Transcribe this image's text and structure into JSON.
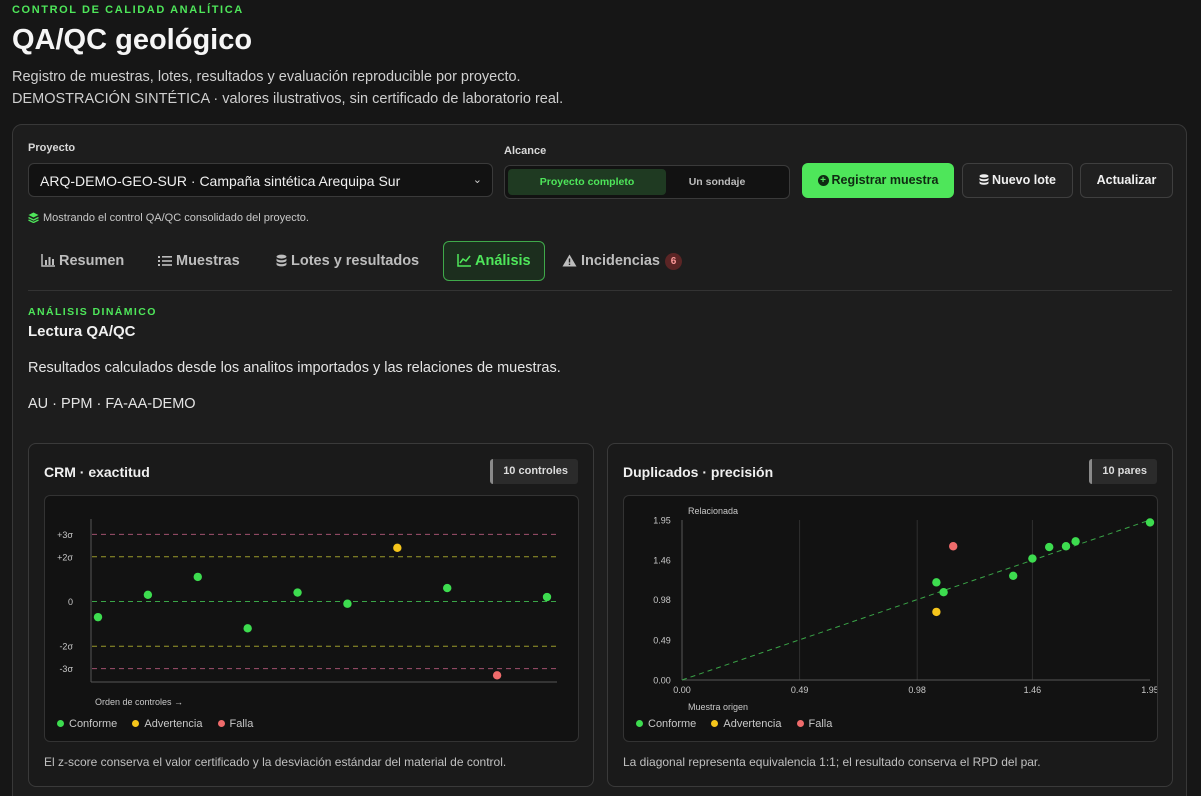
{
  "header": {
    "eyebrow": "CONTROL DE CALIDAD ANALÍTICA",
    "title": "QA/QC geológico",
    "subtitle1": "Registro de muestras, lotes, resultados y evaluación reproducible por proyecto.",
    "subtitle2": "DEMOSTRACIÓN SINTÉTICA · valores ilustrativos, sin certificado de laboratorio real."
  },
  "controls": {
    "project_label": "Proyecto",
    "project_value": "ARQ-DEMO-GEO-SUR · Campaña sintética Arequipa Sur",
    "scope_label": "Alcance",
    "scope_options": [
      "Proyecto completo",
      "Un sondaje"
    ],
    "register_button": "Registrar muestra",
    "new_batch_button": "Nuevo lote",
    "refresh_button": "Actualizar",
    "note": "Mostrando el control QA/QC consolidado del proyecto."
  },
  "tabs": [
    {
      "label": "Resumen",
      "icon": "bar-chart-icon"
    },
    {
      "label": "Muestras",
      "icon": "list-icon"
    },
    {
      "label": "Lotes y resultados",
      "icon": "database-icon"
    },
    {
      "label": "Análisis",
      "icon": "line-chart-icon",
      "active": true
    },
    {
      "label": "Incidencias",
      "icon": "warning-icon",
      "badge": "6"
    }
  ],
  "section": {
    "eyebrow": "ANÁLISIS DINÁMICO",
    "title": "Lectura QA/QC",
    "description": "Resultados calculados desde los analitos importados y las relaciones de muestras.",
    "meta": "AU · PPM · FA-AA-DEMO"
  },
  "colors": {
    "accent": "#4ee65a",
    "conforme": "#3ddc4f",
    "advertencia": "#f5c51b",
    "falla": "#ef6b6b"
  },
  "cards": {
    "crm": {
      "title": "CRM · exactitud",
      "pill": "10 controles",
      "footer": "El z-score conserva el valor certificado y la desviación estándar del material de control."
    },
    "dup": {
      "title": "Duplicados · precisión",
      "pill": "10 pares",
      "footer": "La diagonal representa equivalencia 1:1; el resultado conserva el RPD del par."
    }
  },
  "legend": [
    "Conforme",
    "Advertencia",
    "Falla"
  ],
  "chart_data": [
    {
      "type": "scatter",
      "title": "CRM · exactitud",
      "xlabel": "Orden de controles →",
      "ylabel": "",
      "y_ticks": [
        "+3σ",
        "+2σ",
        "0",
        "-2σ",
        "-3σ"
      ],
      "ylim": [
        -3.6,
        3.6
      ],
      "reference_lines": [
        3,
        2,
        0,
        -2,
        -3
      ],
      "points": [
        {
          "x": 1,
          "y": -0.7,
          "status": "Conforme"
        },
        {
          "x": 2,
          "y": 0.3,
          "status": "Conforme"
        },
        {
          "x": 3,
          "y": 1.1,
          "status": "Conforme"
        },
        {
          "x": 4,
          "y": -1.2,
          "status": "Conforme"
        },
        {
          "x": 5,
          "y": 0.4,
          "status": "Conforme"
        },
        {
          "x": 6,
          "y": -0.1,
          "status": "Conforme"
        },
        {
          "x": 7,
          "y": 2.4,
          "status": "Advertencia"
        },
        {
          "x": 8,
          "y": 0.6,
          "status": "Conforme"
        },
        {
          "x": 9,
          "y": -3.3,
          "status": "Falla"
        },
        {
          "x": 10,
          "y": 0.2,
          "status": "Conforme"
        }
      ],
      "legend": [
        "Conforme",
        "Advertencia",
        "Falla"
      ]
    },
    {
      "type": "scatter",
      "title": "Duplicados · precisión",
      "xlabel": "Muestra origen",
      "ylabel": "Relacionada",
      "x_ticks": [
        "0.00",
        "0.49",
        "0.98",
        "1.46",
        "1.95"
      ],
      "y_ticks": [
        "0.00",
        "0.49",
        "0.98",
        "1.46",
        "1.95"
      ],
      "xlim": [
        0,
        1.95
      ],
      "ylim": [
        0,
        1.95
      ],
      "reference_line": "1:1",
      "points": [
        {
          "x": 1.06,
          "y": 1.19,
          "status": "Conforme"
        },
        {
          "x": 1.09,
          "y": 1.07,
          "status": "Conforme"
        },
        {
          "x": 1.06,
          "y": 0.83,
          "status": "Advertencia"
        },
        {
          "x": 1.13,
          "y": 1.63,
          "status": "Falla"
        },
        {
          "x": 1.38,
          "y": 1.27,
          "status": "Conforme"
        },
        {
          "x": 1.46,
          "y": 1.48,
          "status": "Conforme"
        },
        {
          "x": 1.53,
          "y": 1.62,
          "status": "Conforme"
        },
        {
          "x": 1.6,
          "y": 1.63,
          "status": "Conforme"
        },
        {
          "x": 1.64,
          "y": 1.69,
          "status": "Conforme"
        },
        {
          "x": 1.95,
          "y": 1.92,
          "status": "Conforme"
        }
      ],
      "legend": [
        "Conforme",
        "Advertencia",
        "Falla"
      ]
    }
  ]
}
